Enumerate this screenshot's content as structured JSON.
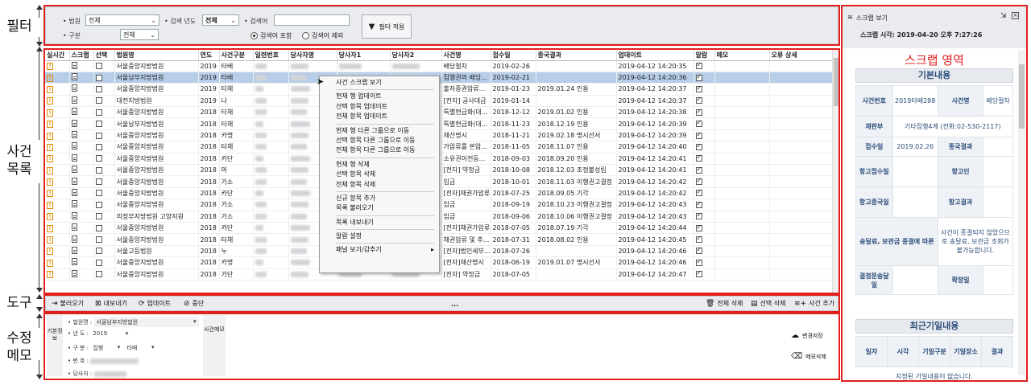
{
  "labels": {
    "filter": "필터",
    "case_list_1": "사건",
    "case_list_2": "목록",
    "tools": "도구",
    "memo_1": "수정",
    "memo_2": "메모",
    "scrap_area": "스크랩 영역"
  },
  "filter": {
    "court_label": "• 법원",
    "court_value": "전체",
    "year_label": "• 검색 년도",
    "year_value": "전체",
    "search_label": "• 검색어",
    "search_value": "",
    "type_label": "• 구분",
    "type_value": "전체",
    "radio_include": "검색어 포함",
    "radio_exclude": "검색어 제외",
    "apply_button": "필터 적용"
  },
  "table": {
    "headers": [
      "실시간",
      "스크랩",
      "선택",
      "법원명",
      "연도",
      "사건구분",
      "일련번호",
      "당사자명",
      "당사자1",
      "당사자2",
      "사건명",
      "접수일",
      "종국결과",
      "업데이트",
      "알람",
      "메모",
      "오류 상세"
    ],
    "rows": [
      {
        "court": "서울중앙지방법원",
        "year": "2019",
        "type": "타배",
        "case": "배당절차",
        "date": "2019-02-26",
        "result": "",
        "update": "2019-04-12 14:20:35",
        "alarm": true
      },
      {
        "court": "서울남부지방법원",
        "year": "2019",
        "type": "타배",
        "case": "집행권의 배당...",
        "date": "2019-02-21",
        "result": "",
        "update": "2019-04-12 14:20:36",
        "alarm": true
      },
      {
        "court": "서울중앙지방법원",
        "year": "2019",
        "type": "타채",
        "case": "출자증권압류...",
        "date": "2019-01-23",
        "result": "2019.01.24 인용",
        "update": "2019-04-12 14:20:37",
        "alarm": true
      },
      {
        "court": "대전지방법원",
        "year": "2019",
        "type": "나",
        "case": "[전자] 공사대금",
        "date": "2019-01-14",
        "result": "",
        "update": "2019-04-12 14:20:37",
        "alarm": true
      },
      {
        "court": "서울중앙지방법원",
        "year": "2018",
        "type": "타채",
        "case": "특별현금화(대...",
        "date": "2018-12-12",
        "result": "2019.01.02 인용",
        "update": "2019-04-12 14:20:38",
        "alarm": true
      },
      {
        "court": "서울남부지방법원",
        "year": "2018",
        "type": "타채",
        "case": "특별현금화(대...",
        "date": "2018-11-23",
        "result": "2018.12.19 인용",
        "update": "2019-04-12 14:20:39",
        "alarm": true
      },
      {
        "court": "서울중앙지방법원",
        "year": "2018",
        "type": "카명",
        "case": "재산명시",
        "date": "2018-11-21",
        "result": "2019.02.18 명시선서",
        "update": "2019-04-12 14:20:39",
        "alarm": true
      },
      {
        "court": "서울중앙지방법원",
        "year": "2018",
        "type": "타채",
        "case": "가압류를 본압...",
        "date": "2018-11-05",
        "result": "2018.11.07 인용",
        "update": "2019-04-12 14:20:40",
        "alarm": true
      },
      {
        "court": "서울중앙지방법원",
        "year": "2018",
        "type": "카단",
        "case": "소유권이전등...",
        "date": "2018-09-03",
        "result": "2018.09.20 인용",
        "update": "2019-04-12 14:20:41",
        "alarm": true
      },
      {
        "court": "서울중앙지방법원",
        "year": "2018",
        "type": "머",
        "case": "[전자] 약정금",
        "date": "2018-10-08",
        "result": "2018.12.03 조정불성립",
        "update": "2019-04-12 14:20:41",
        "alarm": true
      },
      {
        "court": "서울중앙지방법원",
        "year": "2018",
        "type": "가소",
        "case": "임금",
        "date": "2018-10-01",
        "result": "2018.11.03 이행권고결정",
        "update": "2019-04-12 14:20:42",
        "alarm": true
      },
      {
        "court": "서울중앙지방법원",
        "year": "2018",
        "type": "카단",
        "case": "[전자]채권가압류",
        "date": "2018-07-25",
        "result": "2018.09.05 기각",
        "update": "2019-04-12 14:20:42",
        "alarm": true
      },
      {
        "court": "서울중앙지방법원",
        "year": "2018",
        "type": "가소",
        "case": "임금",
        "date": "2018-09-19",
        "result": "2018.10.23 이행권고결정",
        "update": "2019-04-12 14:20:43",
        "alarm": true
      },
      {
        "court": "의정부지방법원 고양지원",
        "year": "2018",
        "type": "가소",
        "case": "임금",
        "date": "2018-09-06",
        "result": "2018.10.06 이행권고결정",
        "update": "2019-04-12 14:20:43",
        "alarm": true
      },
      {
        "court": "서울중앙지방법원",
        "year": "2018",
        "type": "카단",
        "case": "[전자]채권가압류",
        "date": "2018-07-05",
        "result": "2018.07.19 기각",
        "update": "2019-04-12 14:20:44",
        "alarm": true
      },
      {
        "court": "서울중앙지방법원",
        "year": "2018",
        "type": "타채",
        "case": "채권압류 및 추...",
        "date": "2018-07-31",
        "result": "2018.08.02 인용",
        "update": "2019-04-12 14:20:45",
        "alarm": true
      },
      {
        "court": "서울고등법원",
        "year": "2018",
        "type": "누",
        "case": "[전자]법인세부...",
        "date": "2018-07-26",
        "result": "",
        "update": "2019-04-12 14:20:46",
        "alarm": true
      },
      {
        "court": "서울중앙지방법원",
        "year": "2018",
        "type": "카명",
        "case": "[전자]재산명시",
        "date": "2018-06-19",
        "result": "2019.01.07 명시선서",
        "update": "2019-04-12 14:20:46",
        "alarm": true
      },
      {
        "court": "서울중앙지방법원",
        "year": "2018",
        "type": "가단",
        "case": "[전자] 약정금",
        "date": "2018-07-05",
        "result": "",
        "update": "2019-04-12 14:20:47",
        "alarm": true
      }
    ]
  },
  "context_menu": {
    "groups": [
      [
        "사건 스크랩 보기"
      ],
      [
        "현재 행 업데이트",
        "선택 항목 업데이트",
        "전체 항목 업데이트"
      ],
      [
        "현재 행 다른 그룹으로 이동",
        "선택 항목 다른 그룹으로 이동",
        "전체 항목 다른 그룹으로 이동"
      ],
      [
        "현재 행 삭제",
        "선택 항목 삭제",
        "전체 항목 삭제"
      ],
      [
        "신규 항목 추가",
        "목록 불러오기"
      ],
      [
        "목록 내보내기"
      ],
      [
        "알람 설정"
      ],
      [
        "패널 보기/감추기"
      ]
    ]
  },
  "toolbar": {
    "load": "불러오기",
    "export": "내보내기",
    "update": "업데이트",
    "stop": "중단",
    "delete_all": "전체 삭제",
    "delete_selected": "선택 삭제",
    "add_case": "사건 추가",
    "more": "..."
  },
  "memo": {
    "side_label": "기본정보",
    "side2_label": "사건메모",
    "court_label": "• 법원명 :",
    "court_value": "서울남부지방법원",
    "year_label": "• 년  도 :",
    "year_value": "2019",
    "type_label": "• 구  분 :",
    "type_value": "집행",
    "type_value2": "타배",
    "number_label": "• 번  호 :",
    "party_label": "• 당사자 :",
    "save_button": "변경저장",
    "delete_button": "메모삭제"
  },
  "scrap": {
    "title": "스크랩 보기",
    "time": "스크랩 시각: 2019-04-20 오후 7:27:26",
    "basic_title": "기본내용",
    "case_no_k": "사건번호",
    "case_no_v": "2019타배288",
    "case_name_k": "사건명",
    "case_name_v": "배당절차",
    "dept_k": "재판부",
    "dept_v": "기타집행4계 (전화:02-530-2117)",
    "recv_k": "접수일",
    "recv_v": "2019.02.26",
    "final_k": "종국결과",
    "final_v": "",
    "appeal_recv_k": "항고접수일",
    "appeal_person_k": "항고인",
    "appeal_final_k": "항고종국일",
    "appeal_result_k": "항고결과",
    "delivery_k": "송달료, 보관금 종결에 따른",
    "delivery_v": "사건이 종결되지 않았으므로 송달료, 보관금 조회가 불가능합니다.",
    "decision_k": "결정문송달일",
    "confirm_k": "확정일",
    "recent_title": "최근기일내용",
    "recent_headers": [
      "일자",
      "시각",
      "기일구분",
      "기일장소",
      "결과"
    ],
    "recent_empty": "지정된 기일내용이 없습니다."
  },
  "colors": {
    "annotation": "#e0201c",
    "accent_blue": "#2a4d7a",
    "selected_row": "#b7cde8"
  }
}
